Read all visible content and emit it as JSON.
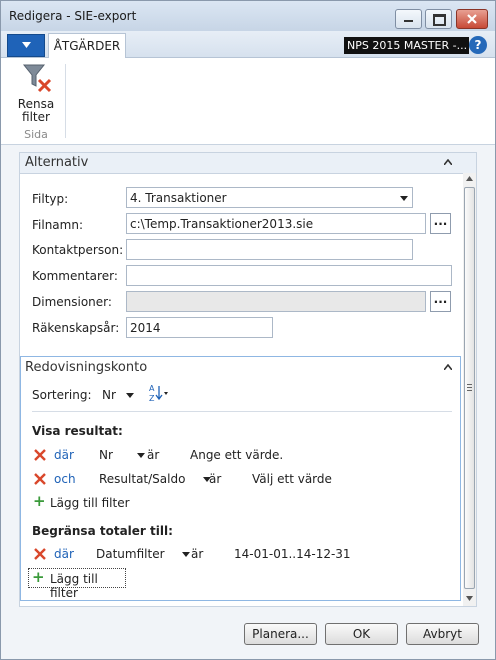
{
  "window": {
    "title": "Redigera - SIE-export"
  },
  "ribbon": {
    "tab_label": "ÅTGÄRDER",
    "company": "NPS 2015 MASTER -...",
    "help": "?",
    "clear_filter_line1": "Rensa",
    "clear_filter_line2": "filter",
    "group_label": "Sida"
  },
  "options": {
    "title": "Alternativ",
    "filetype_label": "Filtyp:",
    "filetype_value": "4. Transaktioner",
    "filename_label": "Filnamn:",
    "filename_value": "c:\\Temp.Transaktioner2013.sie",
    "contact_label": "Kontaktperson:",
    "contact_value": "",
    "comments_label": "Kommentarer:",
    "comments_value": "",
    "dimensions_label": "Dimensioner:",
    "dimensions_value": "",
    "fiscal_year_label": "Räkenskapsår:",
    "fiscal_year_value": "2014",
    "lookup": "..."
  },
  "account": {
    "title": "Redovisningskonto",
    "sort_label": "Sortering:",
    "sort_value": "Nr",
    "show_results": "Visa resultat:",
    "filter1": {
      "conj": "där",
      "field": "Nr",
      "op": "är",
      "value": "Ange ett värde."
    },
    "filter2": {
      "conj": "och",
      "field": "Resultat/Saldo",
      "op": "är",
      "value": "Välj ett värde"
    },
    "add_filter": "Lägg till filter",
    "limit_totals": "Begränsa totaler till:",
    "filter3": {
      "conj": "där",
      "field": "Datumfilter",
      "op": "är",
      "value": "14-01-01..14-12-31"
    },
    "add_filter2": "Lägg till filter"
  },
  "buttons": {
    "plan": "Planera...",
    "ok": "OK",
    "cancel": "Avbryt"
  },
  "colors": {
    "accent": "#1f62b7",
    "remove": "#d9472b",
    "add": "#3a9a3a"
  }
}
